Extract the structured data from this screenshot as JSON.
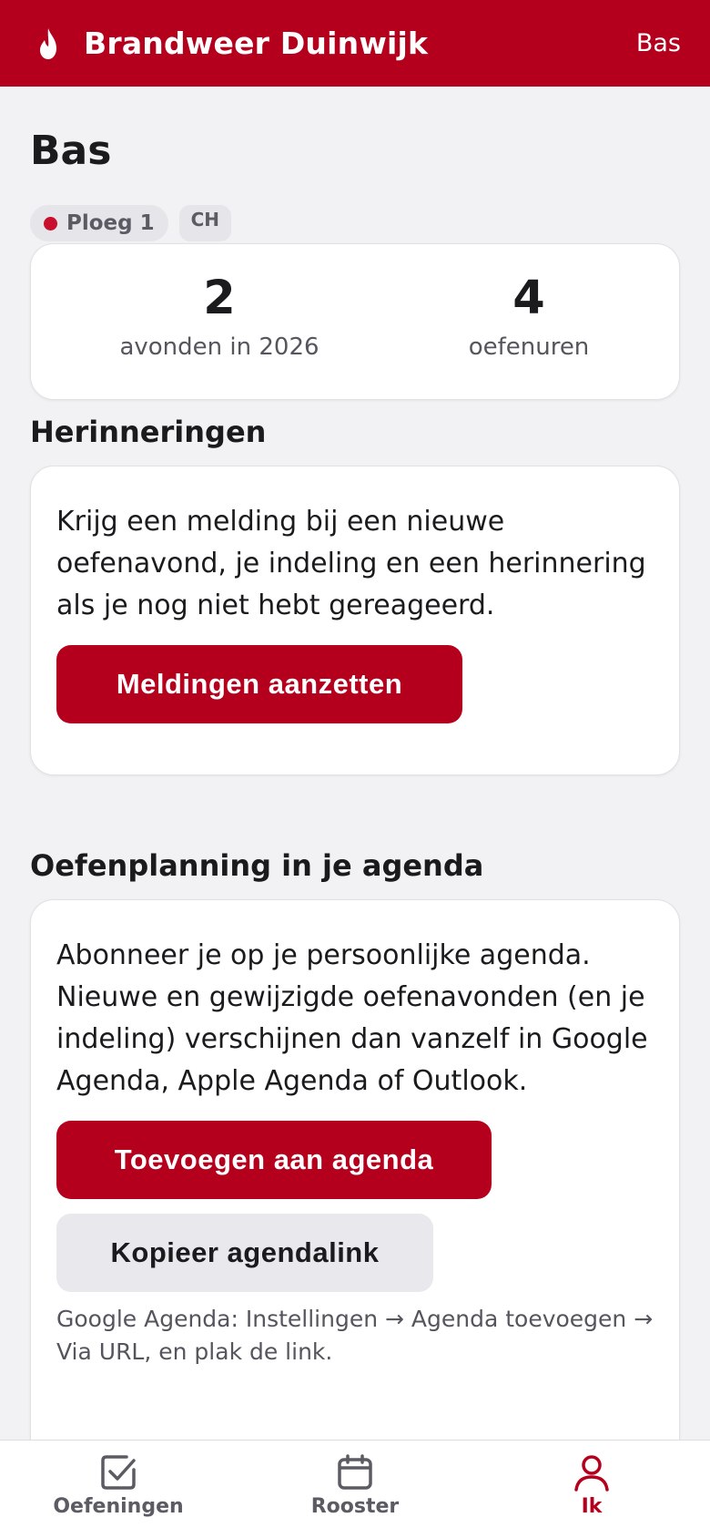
{
  "header": {
    "brand": "Brandweer Duinwijk",
    "user": "Bas"
  },
  "profile": {
    "name": "Bas",
    "chips": [
      {
        "label": "Ploeg 1",
        "color": "#c8102e"
      },
      {
        "label": "CH"
      }
    ],
    "stats": [
      {
        "value": "2",
        "label": "avonden in 2026"
      },
      {
        "value": "4",
        "label": "oefenuren"
      }
    ]
  },
  "reminders": {
    "title": "Herinneringen",
    "text": "Krijg een melding bij een nieuwe oefenavond, je indeling en een herinnering als je nog niet hebt gereageerd.",
    "button": "Meldingen aanzetten"
  },
  "calendar": {
    "title": "Oefenplanning in je agenda",
    "text": "Abonneer je op je persoonlijke agenda. Nieuwe en gewijzigde oefenavonden (en je indeling) verschijnen dan vanzelf in Google Agenda, Apple Agenda of Outlook.",
    "add_button": "Toevoegen aan agenda",
    "copy_button": "Kopieer agendalink",
    "hint": "Google Agenda: Instellingen → Agenda toevoegen → Via URL, en plak de link."
  },
  "nav": {
    "items": [
      {
        "label": "Oefeningen",
        "icon": "checkbox-icon"
      },
      {
        "label": "Rooster",
        "icon": "calendar-icon"
      },
      {
        "label": "Ik",
        "icon": "person-icon",
        "active": true
      }
    ]
  },
  "colors": {
    "brand": "#b5001d",
    "background": "#f2f2f4",
    "muted_text": "#55555d"
  }
}
